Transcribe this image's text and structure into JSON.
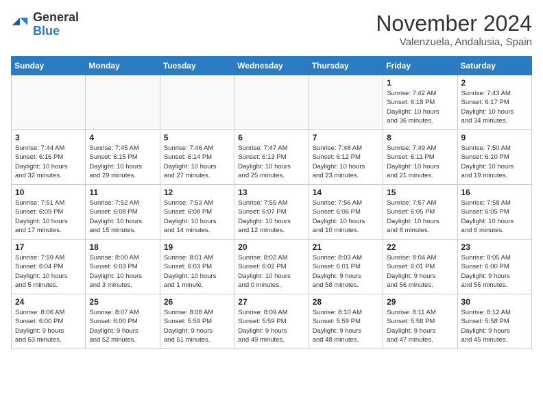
{
  "header": {
    "logo_line1": "General",
    "logo_line2": "Blue",
    "month": "November 2024",
    "location": "Valenzuela, Andalusia, Spain"
  },
  "weekdays": [
    "Sunday",
    "Monday",
    "Tuesday",
    "Wednesday",
    "Thursday",
    "Friday",
    "Saturday"
  ],
  "weeks": [
    [
      {
        "day": "",
        "text": ""
      },
      {
        "day": "",
        "text": ""
      },
      {
        "day": "",
        "text": ""
      },
      {
        "day": "",
        "text": ""
      },
      {
        "day": "",
        "text": ""
      },
      {
        "day": "1",
        "text": "Sunrise: 7:42 AM\nSunset: 6:18 PM\nDaylight: 10 hours\nand 36 minutes."
      },
      {
        "day": "2",
        "text": "Sunrise: 7:43 AM\nSunset: 6:17 PM\nDaylight: 10 hours\nand 34 minutes."
      }
    ],
    [
      {
        "day": "3",
        "text": "Sunrise: 7:44 AM\nSunset: 6:16 PM\nDaylight: 10 hours\nand 32 minutes."
      },
      {
        "day": "4",
        "text": "Sunrise: 7:45 AM\nSunset: 6:15 PM\nDaylight: 10 hours\nand 29 minutes."
      },
      {
        "day": "5",
        "text": "Sunrise: 7:46 AM\nSunset: 6:14 PM\nDaylight: 10 hours\nand 27 minutes."
      },
      {
        "day": "6",
        "text": "Sunrise: 7:47 AM\nSunset: 6:13 PM\nDaylight: 10 hours\nand 25 minutes."
      },
      {
        "day": "7",
        "text": "Sunrise: 7:48 AM\nSunset: 6:12 PM\nDaylight: 10 hours\nand 23 minutes."
      },
      {
        "day": "8",
        "text": "Sunrise: 7:49 AM\nSunset: 6:11 PM\nDaylight: 10 hours\nand 21 minutes."
      },
      {
        "day": "9",
        "text": "Sunrise: 7:50 AM\nSunset: 6:10 PM\nDaylight: 10 hours\nand 19 minutes."
      }
    ],
    [
      {
        "day": "10",
        "text": "Sunrise: 7:51 AM\nSunset: 6:09 PM\nDaylight: 10 hours\nand 17 minutes."
      },
      {
        "day": "11",
        "text": "Sunrise: 7:52 AM\nSunset: 6:08 PM\nDaylight: 10 hours\nand 15 minutes."
      },
      {
        "day": "12",
        "text": "Sunrise: 7:53 AM\nSunset: 6:08 PM\nDaylight: 10 hours\nand 14 minutes."
      },
      {
        "day": "13",
        "text": "Sunrise: 7:55 AM\nSunset: 6:07 PM\nDaylight: 10 hours\nand 12 minutes."
      },
      {
        "day": "14",
        "text": "Sunrise: 7:56 AM\nSunset: 6:06 PM\nDaylight: 10 hours\nand 10 minutes."
      },
      {
        "day": "15",
        "text": "Sunrise: 7:57 AM\nSunset: 6:05 PM\nDaylight: 10 hours\nand 8 minutes."
      },
      {
        "day": "16",
        "text": "Sunrise: 7:58 AM\nSunset: 6:05 PM\nDaylight: 10 hours\nand 6 minutes."
      }
    ],
    [
      {
        "day": "17",
        "text": "Sunrise: 7:59 AM\nSunset: 6:04 PM\nDaylight: 10 hours\nand 5 minutes."
      },
      {
        "day": "18",
        "text": "Sunrise: 8:00 AM\nSunset: 6:03 PM\nDaylight: 10 hours\nand 3 minutes."
      },
      {
        "day": "19",
        "text": "Sunrise: 8:01 AM\nSunset: 6:03 PM\nDaylight: 10 hours\nand 1 minute."
      },
      {
        "day": "20",
        "text": "Sunrise: 8:02 AM\nSunset: 6:02 PM\nDaylight: 10 hours\nand 0 minutes."
      },
      {
        "day": "21",
        "text": "Sunrise: 8:03 AM\nSunset: 6:01 PM\nDaylight: 9 hours\nand 58 minutes."
      },
      {
        "day": "22",
        "text": "Sunrise: 8:04 AM\nSunset: 6:01 PM\nDaylight: 9 hours\nand 56 minutes."
      },
      {
        "day": "23",
        "text": "Sunrise: 8:05 AM\nSunset: 6:00 PM\nDaylight: 9 hours\nand 55 minutes."
      }
    ],
    [
      {
        "day": "24",
        "text": "Sunrise: 8:06 AM\nSunset: 6:00 PM\nDaylight: 9 hours\nand 53 minutes."
      },
      {
        "day": "25",
        "text": "Sunrise: 8:07 AM\nSunset: 6:00 PM\nDaylight: 9 hours\nand 52 minutes."
      },
      {
        "day": "26",
        "text": "Sunrise: 8:08 AM\nSunset: 5:59 PM\nDaylight: 9 hours\nand 51 minutes."
      },
      {
        "day": "27",
        "text": "Sunrise: 8:09 AM\nSunset: 5:59 PM\nDaylight: 9 hours\nand 49 minutes."
      },
      {
        "day": "28",
        "text": "Sunrise: 8:10 AM\nSunset: 5:59 PM\nDaylight: 9 hours\nand 48 minutes."
      },
      {
        "day": "29",
        "text": "Sunrise: 8:11 AM\nSunset: 5:58 PM\nDaylight: 9 hours\nand 47 minutes."
      },
      {
        "day": "30",
        "text": "Sunrise: 8:12 AM\nSunset: 5:58 PM\nDaylight: 9 hours\nand 45 minutes."
      }
    ]
  ]
}
